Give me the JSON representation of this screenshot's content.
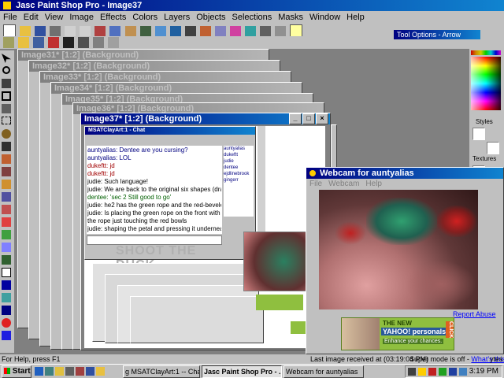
{
  "app": {
    "title": "Jasc Paint Shop Pro - Image37",
    "menu": [
      "File",
      "Edit",
      "View",
      "Image",
      "Effects",
      "Colors",
      "Layers",
      "Objects",
      "Selections",
      "Masks",
      "Window",
      "Help"
    ],
    "tool_options_title": "Tool Options - Arrow"
  },
  "doc_windows": [
    "Image31* [1:2] (Background)",
    "Image32* [1:2] (Background)",
    "Image33* [1:2] (Background)",
    "Image34* [1:2] (Background)",
    "Image35* [1:2] (Background)",
    "Image36* [1:2] (Background)",
    "Image37* [1:2] (Background)"
  ],
  "right_panel": {
    "styles_label": "Styles",
    "textures_label": "Textures"
  },
  "chat": {
    "title": "MSATClayArt:1 - Chat",
    "lines": [
      "auntyalias: Dentee are you cursing?",
      "auntyalias: LOL",
      "dukeftt: jd",
      "dukeftt: jd",
      "judie: Such language!",
      "judie: We are back to the original six shapes (dragonfly)",
      "dentee: 'sec 2 Still good to go'",
      "judie: he2 has the green rope and the red-beveled eyeball cone",
      "judie: Is placing the green rope on the front with the top of",
      "  the rope just touching the red bowls",
      "judie: shaping the petal and pressing it underneath to the rope"
    ],
    "users": [
      "auntyalias",
      "dukeftt",
      "judie",
      "dentee",
      "ejdlinebrook",
      "gingerr"
    ],
    "banner": "SHOOT THE DUCK"
  },
  "webcam": {
    "title": "Webcam for auntyalias",
    "menu": [
      "File",
      "Webcam",
      "Help"
    ],
    "report_abuse": "Report Abuse",
    "ad_line1": "THE NEW",
    "ad_line2": "YAHOO! personals",
    "ad_line3": "Enhance your chances.",
    "ad_click": "CLICK",
    "status_left": "Last image received at (03:19:04 PM)",
    "status_right_prefix": "Super mode is off - ",
    "status_right_link": "What's this?"
  },
  "status": {
    "help": "For Help, press F1",
    "layer_text": "ytes"
  },
  "taskbar": {
    "start": "Start",
    "tasks": [
      "g MSATClayArt:1 -- Chat",
      "Jasc Paint Shop Pro - ...",
      "Webcam for auntyalias"
    ],
    "clock": "3:19 PM"
  },
  "colors": {
    "titlebar_active": "#000080",
    "titlebar_inactive": "#808080",
    "face": "#c0c0c0",
    "yahoo_green": "#8fbf3f",
    "link": "#0000ff"
  }
}
